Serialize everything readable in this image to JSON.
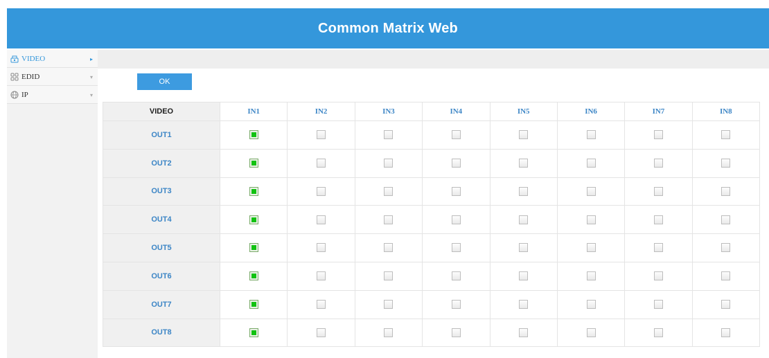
{
  "header": {
    "title": "Common Matrix Web"
  },
  "sidebar": {
    "items": [
      {
        "label": "VIDEO",
        "icon": "video-icon",
        "arrow": "▸",
        "active": true
      },
      {
        "label": "EDID",
        "icon": "grid-icon",
        "arrow": "▾",
        "active": false
      },
      {
        "label": "IP",
        "icon": "globe-icon",
        "arrow": "▾",
        "active": false
      }
    ]
  },
  "toolbar": {
    "ok_label": "OK"
  },
  "matrix": {
    "corner_label": "VIDEO",
    "inputs": [
      "IN1",
      "IN2",
      "IN3",
      "IN4",
      "IN5",
      "IN6",
      "IN7",
      "IN8"
    ],
    "outputs": [
      "OUT1",
      "OUT2",
      "OUT3",
      "OUT4",
      "OUT5",
      "OUT6",
      "OUT7",
      "OUT8"
    ],
    "routing": [
      1,
      1,
      1,
      1,
      1,
      1,
      1,
      1
    ]
  },
  "colors": {
    "header": "#3497db",
    "accent": "#3d86c6",
    "checked": "#11c211"
  }
}
